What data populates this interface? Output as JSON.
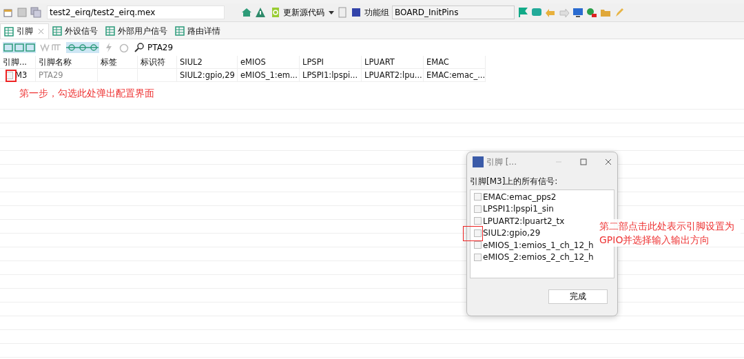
{
  "toolbar": {
    "file_path": "test2_eirq/test2_eirq.mex",
    "update_button": "更新源代码",
    "function_group_label": "功能组",
    "function_group": "BOARD_InitPins"
  },
  "tabs": [
    {
      "label": "引脚",
      "selected": true,
      "closable": true
    },
    {
      "label": "外设信号",
      "selected": false,
      "closable": false
    },
    {
      "label": "外部用户信号",
      "selected": false,
      "closable": false
    },
    {
      "label": "路由详情",
      "selected": false,
      "closable": false
    }
  ],
  "filter": {
    "value": "PTA29"
  },
  "table": {
    "columns": [
      "引脚...",
      "引脚名称",
      "标签",
      "标识符",
      "SIUL2",
      "eMIOS",
      "LPSPI",
      "LPUART",
      "EMAC"
    ],
    "rows": [
      {
        "checked": false,
        "cells": [
          "M3",
          "PTA29",
          "",
          "",
          "SIUL2:gpio,29",
          "eMIOS_1:em...",
          "LPSPI1:lpspi...",
          "LPUART2:lpu...",
          "EMAC:emac_..."
        ]
      }
    ]
  },
  "dialog": {
    "title": "引脚 [...",
    "prompt": "引脚[M3]上的所有信号:",
    "signals": [
      {
        "label": "EMAC:emac_pps2",
        "checked": false
      },
      {
        "label": "LPSPI1:lpspi1_sin",
        "checked": false
      },
      {
        "label": "LPUART2:lpuart2_tx",
        "checked": false
      },
      {
        "label": "SIUL2:gpio,29",
        "checked": false
      },
      {
        "label": "eMIOS_1:emios_1_ch_12_h",
        "checked": false
      },
      {
        "label": "eMIOS_2:emios_2_ch_12_h",
        "checked": false
      }
    ],
    "button": "完成"
  },
  "annotations": [
    {
      "text": "第一步，勾选此处弹出配置界面"
    },
    {
      "text": "第二部点击此处表示引脚设置为GPIO并选择输入输出方向"
    }
  ]
}
